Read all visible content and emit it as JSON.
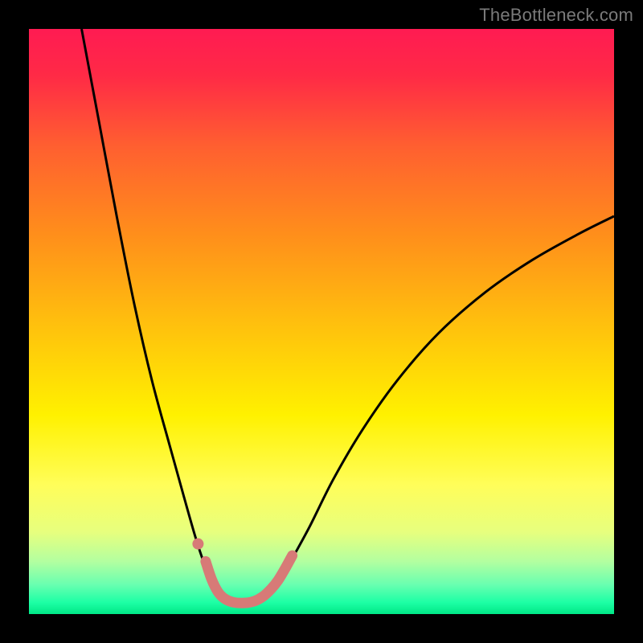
{
  "watermark": "TheBottleneck.com",
  "chart_data": {
    "type": "line",
    "title": "",
    "xlabel": "",
    "ylabel": "",
    "xlim": [
      0,
      100
    ],
    "ylim": [
      0,
      100
    ],
    "background_gradient": {
      "stops": [
        {
          "t": 0.0,
          "color": "#ff1b52"
        },
        {
          "t": 0.08,
          "color": "#ff2a46"
        },
        {
          "t": 0.2,
          "color": "#ff5f30"
        },
        {
          "t": 0.35,
          "color": "#ff8e1b"
        },
        {
          "t": 0.52,
          "color": "#ffc50c"
        },
        {
          "t": 0.66,
          "color": "#fff100"
        },
        {
          "t": 0.78,
          "color": "#fffe5a"
        },
        {
          "t": 0.86,
          "color": "#e7ff7e"
        },
        {
          "t": 0.91,
          "color": "#b3ffa0"
        },
        {
          "t": 0.95,
          "color": "#68ffb0"
        },
        {
          "t": 0.98,
          "color": "#1dffa5"
        },
        {
          "t": 1.0,
          "color": "#00e887"
        }
      ]
    },
    "series": [
      {
        "name": "curve",
        "stroke": "#000000",
        "stroke_width": 3,
        "points": [
          {
            "x": 9.0,
            "y": 100.0
          },
          {
            "x": 12.0,
            "y": 84.0
          },
          {
            "x": 15.0,
            "y": 68.0
          },
          {
            "x": 18.0,
            "y": 53.0
          },
          {
            "x": 21.0,
            "y": 40.0
          },
          {
            "x": 24.0,
            "y": 29.0
          },
          {
            "x": 26.5,
            "y": 20.0
          },
          {
            "x": 28.5,
            "y": 13.0
          },
          {
            "x": 30.0,
            "y": 8.5
          },
          {
            "x": 31.5,
            "y": 5.0
          },
          {
            "x": 33.0,
            "y": 3.0
          },
          {
            "x": 34.5,
            "y": 2.0
          },
          {
            "x": 36.5,
            "y": 1.8
          },
          {
            "x": 39.0,
            "y": 2.3
          },
          {
            "x": 41.0,
            "y": 3.5
          },
          {
            "x": 43.0,
            "y": 6.0
          },
          {
            "x": 45.0,
            "y": 9.5
          },
          {
            "x": 48.0,
            "y": 15.0
          },
          {
            "x": 52.0,
            "y": 23.0
          },
          {
            "x": 57.0,
            "y": 31.5
          },
          {
            "x": 63.0,
            "y": 40.0
          },
          {
            "x": 70.0,
            "y": 48.0
          },
          {
            "x": 78.0,
            "y": 55.0
          },
          {
            "x": 86.0,
            "y": 60.5
          },
          {
            "x": 94.0,
            "y": 65.0
          },
          {
            "x": 100.0,
            "y": 68.0
          }
        ]
      },
      {
        "name": "highlight",
        "stroke": "#d77a77",
        "stroke_width": 13,
        "stroke_linecap": "round",
        "points": [
          {
            "x": 30.2,
            "y": 9.0
          },
          {
            "x": 31.2,
            "y": 6.0
          },
          {
            "x": 32.3,
            "y": 3.8
          },
          {
            "x": 33.5,
            "y": 2.6
          },
          {
            "x": 35.0,
            "y": 2.0
          },
          {
            "x": 36.8,
            "y": 1.9
          },
          {
            "x": 38.5,
            "y": 2.2
          },
          {
            "x": 40.0,
            "y": 3.0
          },
          {
            "x": 41.4,
            "y": 4.3
          },
          {
            "x": 42.6,
            "y": 5.8
          },
          {
            "x": 43.8,
            "y": 7.8
          },
          {
            "x": 45.0,
            "y": 10.0
          }
        ]
      },
      {
        "name": "highlight-dot",
        "type": "marker",
        "fill": "#d77a77",
        "r": 7,
        "points": [
          {
            "x": 28.9,
            "y": 12.0
          }
        ]
      }
    ]
  }
}
